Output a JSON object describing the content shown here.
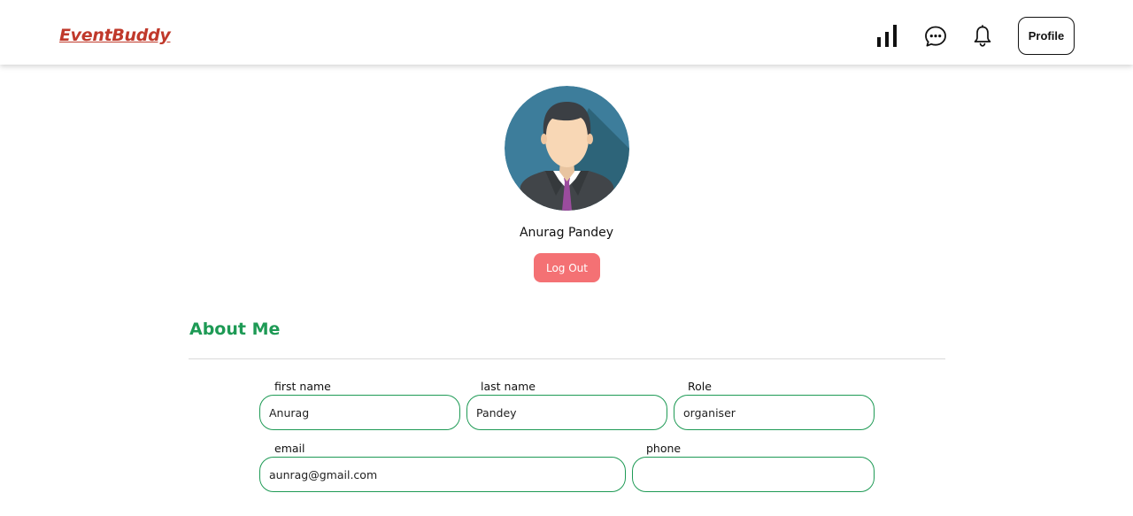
{
  "navbar": {
    "brand": "EventBuddy",
    "icons": [
      "bar-chart-icon",
      "chat-icon",
      "bell-icon"
    ],
    "profile_label": "Profile"
  },
  "profile": {
    "name": "Anurag Pandey",
    "logout_label": "Log Out"
  },
  "about": {
    "title": "About Me",
    "fields": {
      "first_name": {
        "label": "first name",
        "value": "Anurag"
      },
      "last_name": {
        "label": "last name",
        "value": "Pandey"
      },
      "role": {
        "label": "Role",
        "value": "organiser"
      },
      "email": {
        "label": "email",
        "value": "aunrag@gmail.com"
      },
      "phone": {
        "label": "phone",
        "value": ""
      }
    }
  },
  "colors": {
    "brand": "#c0392b",
    "accent_green": "#1e9a55",
    "logout_bg": "#f47174"
  }
}
